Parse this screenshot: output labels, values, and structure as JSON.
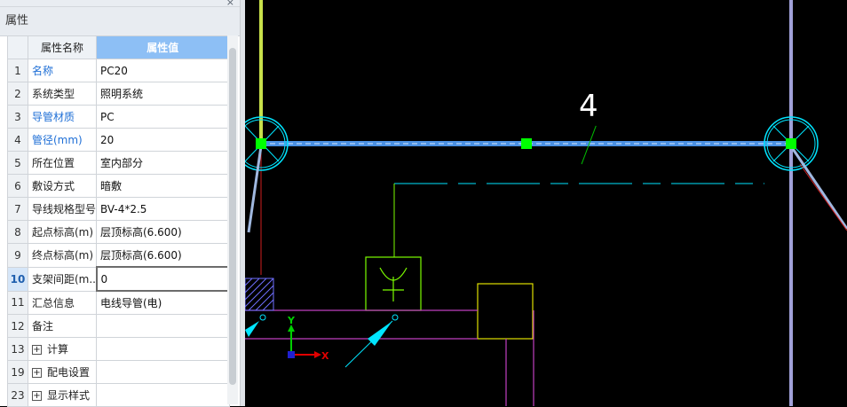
{
  "panel": {
    "title": "属性",
    "close_glyph": "×",
    "header_name": "属性名称",
    "header_value": "属性值",
    "rows": [
      {
        "num": "1",
        "name": "名称",
        "value": "PC20"
      },
      {
        "num": "2",
        "name": "系统类型",
        "value": "照明系统"
      },
      {
        "num": "3",
        "name": "导管材质",
        "value": "PC"
      },
      {
        "num": "4",
        "name": "管径(mm)",
        "value": "20"
      },
      {
        "num": "5",
        "name": "所在位置",
        "value": "室内部分"
      },
      {
        "num": "6",
        "name": "敷设方式",
        "value": "暗敷"
      },
      {
        "num": "7",
        "name": "导线规格型号",
        "value": "BV-4*2.5"
      },
      {
        "num": "8",
        "name": "起点标高(m)",
        "value": "层顶标高(6.600)"
      },
      {
        "num": "9",
        "name": "终点标高(m)",
        "value": "层顶标高(6.600)"
      },
      {
        "num": "10",
        "name": "支架间距(m...",
        "value": "0"
      },
      {
        "num": "11",
        "name": "汇总信息",
        "value": "电线导管(电)"
      },
      {
        "num": "12",
        "name": "备注",
        "value": ""
      },
      {
        "num": "13",
        "name": "计算",
        "value": ""
      },
      {
        "num": "19",
        "name": "配电设置",
        "value": ""
      },
      {
        "num": "23",
        "name": "显示样式",
        "value": ""
      }
    ]
  },
  "canvas": {
    "label_4": "4",
    "axis_x": "X",
    "axis_y": "Y",
    "colors": {
      "background": "#000000",
      "pipe": "#4a90e2",
      "grip": "#00ff00",
      "cyan": "#00e5ff",
      "green_line": "#7cfc00",
      "magenta": "#c040c0",
      "yellow": "#e0e000",
      "wall": "#a0a0d8"
    }
  }
}
